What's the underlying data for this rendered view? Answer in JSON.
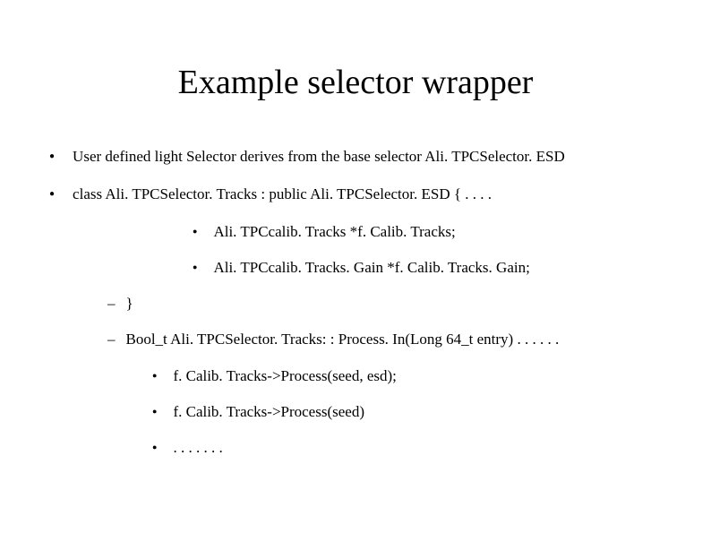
{
  "title": "Example selector wrapper",
  "bullets": [
    "User defined light Selector derives from the base selector Ali. TPCSelector. ESD",
    "class Ali. TPCSelector. Tracks : public Ali. TPCSelector. ESD { . . . ."
  ],
  "subbullets": [
    "Ali. TPCcalib. Tracks *f. Calib. Tracks;",
    "Ali. TPCcalib. Tracks. Gain *f. Calib. Tracks. Gain;"
  ],
  "dashes": [
    "}",
    "Bool_t Ali. TPCSelector. Tracks: : Process. In(Long 64_t entry) . . . . . ."
  ],
  "innerbullets": [
    "f. Calib. Tracks->Process(seed, esd);",
    "f. Calib. Tracks->Process(seed)",
    ". . . . . . ."
  ]
}
